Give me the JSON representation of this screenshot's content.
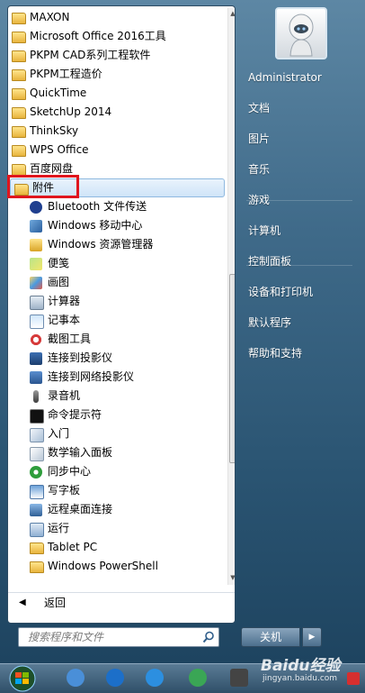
{
  "programs": {
    "folders": [
      {
        "label": "MAXON"
      },
      {
        "label": "Microsoft Office 2016工具"
      },
      {
        "label": "PKPM CAD系列工程软件"
      },
      {
        "label": "PKPM工程造价"
      },
      {
        "label": "QuickTime"
      },
      {
        "label": "SketchUp 2014"
      },
      {
        "label": "ThinkSky"
      },
      {
        "label": "WPS Office"
      },
      {
        "label": "百度网盘"
      }
    ],
    "selected_folder": {
      "label": "附件"
    },
    "accessories": [
      {
        "label": "Bluetooth 文件传送",
        "icon": "bluetooth-icon"
      },
      {
        "label": "Windows 移动中心",
        "icon": "mobility-center-icon"
      },
      {
        "label": "Windows 资源管理器",
        "icon": "explorer-icon"
      },
      {
        "label": "便笺",
        "icon": "sticky-notes-icon"
      },
      {
        "label": "画图",
        "icon": "paint-icon"
      },
      {
        "label": "计算器",
        "icon": "calculator-icon"
      },
      {
        "label": "记事本",
        "icon": "notepad-icon"
      },
      {
        "label": "截图工具",
        "icon": "snipping-tool-icon"
      },
      {
        "label": "连接到投影仪",
        "icon": "projector-icon"
      },
      {
        "label": "连接到网络投影仪",
        "icon": "network-projector-icon"
      },
      {
        "label": "录音机",
        "icon": "sound-recorder-icon"
      },
      {
        "label": "命令提示符",
        "icon": "command-prompt-icon"
      },
      {
        "label": "入门",
        "icon": "getting-started-icon"
      },
      {
        "label": "数学输入面板",
        "icon": "math-input-icon"
      },
      {
        "label": "同步中心",
        "icon": "sync-center-icon"
      },
      {
        "label": "写字板",
        "icon": "wordpad-icon"
      },
      {
        "label": "远程桌面连接",
        "icon": "remote-desktop-icon"
      },
      {
        "label": "运行",
        "icon": "run-icon"
      },
      {
        "label": "Tablet PC",
        "icon": "folder-icon"
      },
      {
        "label": "Windows PowerShell",
        "icon": "folder-icon"
      }
    ]
  },
  "back": {
    "label": "返回"
  },
  "search": {
    "placeholder": "搜索程序和文件"
  },
  "right_pane": {
    "user": "Administrator",
    "items": [
      {
        "label": "文档"
      },
      {
        "label": "图片"
      },
      {
        "label": "音乐"
      },
      {
        "label": "游戏"
      },
      {
        "label": "计算机"
      },
      {
        "label": "控制面板"
      },
      {
        "label": "设备和打印机"
      },
      {
        "label": "默认程序"
      },
      {
        "label": "帮助和支持"
      }
    ]
  },
  "shutdown": {
    "label": "关机"
  },
  "watermark": {
    "text": "Baidu经验",
    "sub": "jingyan.baidu.com"
  },
  "colors": {
    "highlight": "#e0161e",
    "selected_bg": "#cfe4f8",
    "menu_blue": "#3f6a89"
  }
}
